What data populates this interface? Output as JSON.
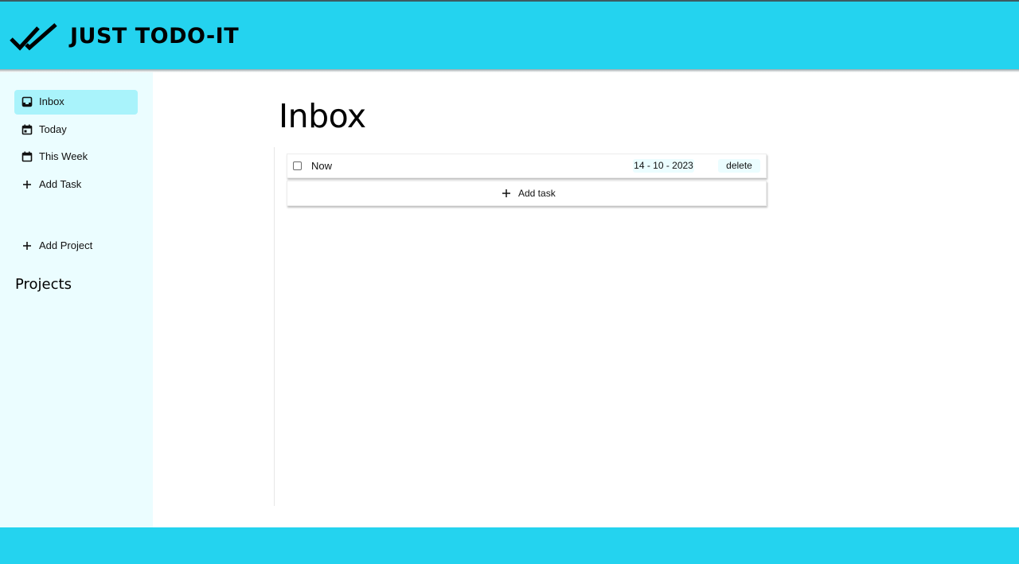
{
  "header": {
    "title": "JUST TODO-IT",
    "logo_icon": "double-check-icon"
  },
  "sidebar": {
    "items": [
      {
        "label": "Inbox",
        "icon": "inbox-icon",
        "active": true
      },
      {
        "label": "Today",
        "icon": "calendar-icon",
        "active": false
      },
      {
        "label": "This Week",
        "icon": "calendar-icon",
        "active": false
      },
      {
        "label": "Add Task",
        "icon": "plus-icon",
        "active": false
      }
    ],
    "projects_heading": "Projects",
    "add_project_label": "Add Project"
  },
  "main": {
    "title": "Inbox",
    "tasks": [
      {
        "title": "Now",
        "date": "14 - 10 - 2023",
        "delete_label": "delete",
        "done": false
      }
    ],
    "add_task_label": "Add task"
  },
  "colors": {
    "accent": "#24d3ef",
    "sidebar_bg": "#ebfdff",
    "active_item_bg": "#a9f3fb"
  }
}
